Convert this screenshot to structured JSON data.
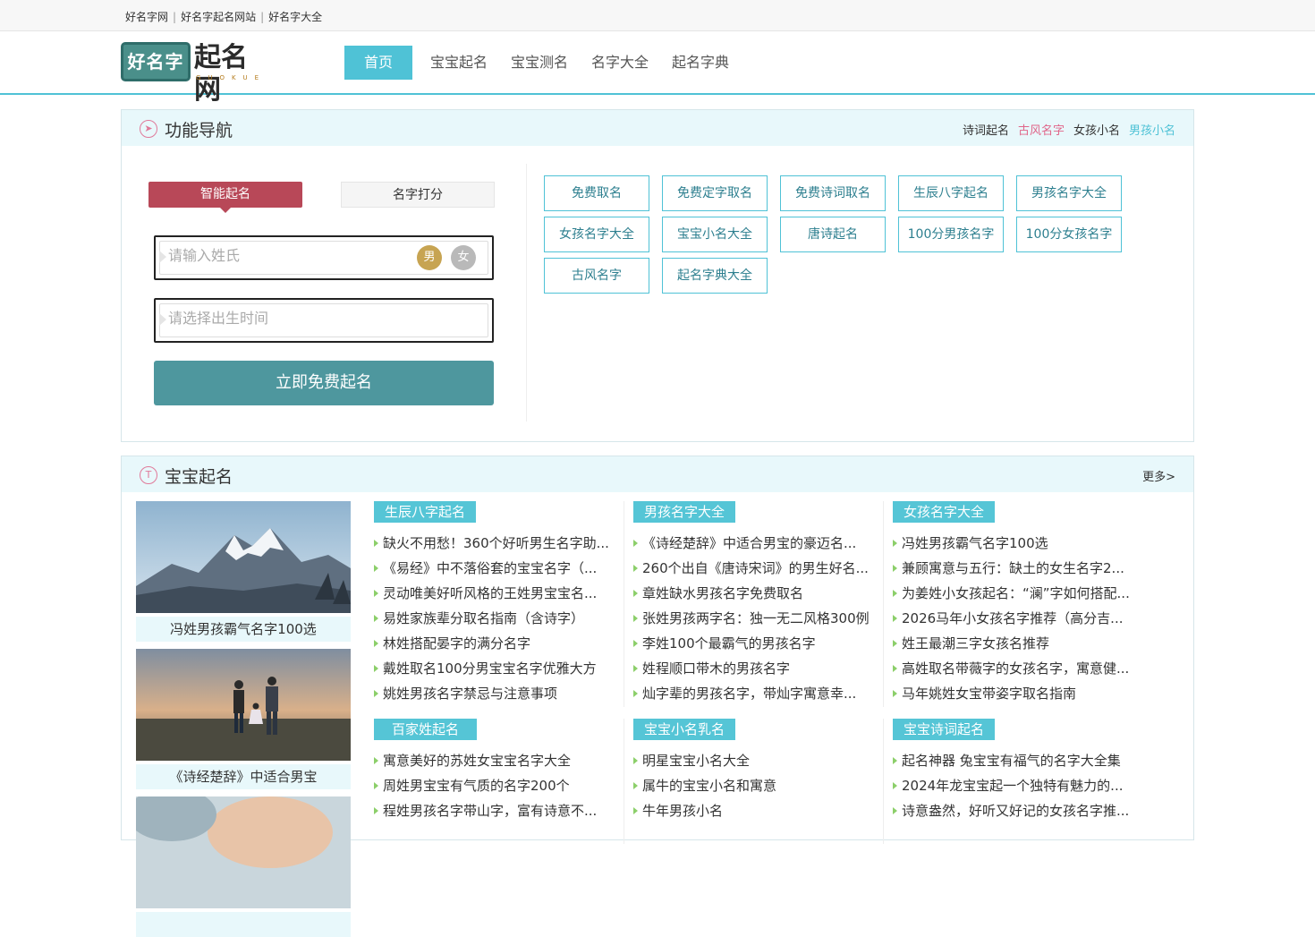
{
  "topbar": {
    "links": [
      "好名字网",
      "好名字起名网站",
      "好名字大全"
    ]
  },
  "logo": {
    "seal": "好名字",
    "text": "起名网",
    "sub": "GUOKUE"
  },
  "nav": [
    {
      "label": "首页",
      "active": true
    },
    {
      "label": "宝宝起名"
    },
    {
      "label": "宝宝测名"
    },
    {
      "label": "名字大全"
    },
    {
      "label": "起名字典"
    }
  ],
  "feature_panel": {
    "title": "功能导航",
    "head_links": [
      {
        "label": "诗词起名",
        "color": "#333333"
      },
      {
        "label": "古风名字",
        "color": "#e0668a"
      },
      {
        "label": "女孩小名",
        "color": "#333333"
      },
      {
        "label": "男孩小名",
        "color": "#4fc2d6"
      }
    ],
    "tabs": [
      "智能起名",
      "名字打分"
    ],
    "surname_placeholder": "请输入姓氏",
    "gender_male": "男",
    "gender_female": "女",
    "birth_placeholder": "请选择出生时间",
    "submit": "立即免费起名",
    "tools": [
      "免费取名",
      "免费定字取名",
      "免费诗词取名",
      "生辰八字起名",
      "男孩名字大全",
      "女孩名字大全",
      "宝宝小名大全",
      "唐诗起名",
      "100分男孩名字",
      "100分女孩名字",
      "古风名字",
      "起名字典大全"
    ]
  },
  "baby_panel": {
    "title": "宝宝起名",
    "more": "更多>",
    "thumbs": [
      {
        "caption": "冯姓男孩霸气名字100选",
        "image": "snowy-mountain"
      },
      {
        "caption": "《诗经楚辞》中适合男宝",
        "image": "family-walk-sunset"
      },
      {
        "caption": "",
        "image": "baby-photo"
      }
    ],
    "columns_row1": [
      {
        "tag": "生辰八字起名",
        "items": [
          "缺火不用愁！360个好听男生名字助...",
          "《易经》中不落俗套的宝宝名字（...",
          "灵动唯美好听风格的王姓男宝宝名...",
          "易姓家族辈分取名指南（含诗字）",
          "林姓搭配晏字的满分名字",
          "戴姓取名100分男宝宝名字优雅大方",
          "姚姓男孩名字禁忌与注意事项"
        ]
      },
      {
        "tag": "男孩名字大全",
        "items": [
          "《诗经楚辞》中适合男宝的豪迈名...",
          "260个出自《唐诗宋词》的男生好名...",
          "章姓缺水男孩名字免费取名",
          "张姓男孩两字名：独一无二风格300例",
          "李姓100个最霸气的男孩名字",
          "姓程顺口带木的男孩名字",
          "灿字辈的男孩名字，带灿字寓意幸..."
        ]
      },
      {
        "tag": "女孩名字大全",
        "items": [
          "冯姓男孩霸气名字100选",
          "兼顾寓意与五行：缺土的女生名字2...",
          "为姜姓小女孩起名：“澜”字如何搭配...",
          "2026马年小女孩名字推荐（高分吉...",
          "姓王最潮三字女孩名推荐",
          "高姓取名带薇字的女孩名字，寓意健...",
          "马年姚姓女宝带姿字取名指南"
        ]
      }
    ],
    "columns_row2": [
      {
        "tag": "百家姓起名",
        "items": [
          "寓意美好的苏姓女宝宝名字大全",
          "周姓男宝宝有气质的名字200个",
          "程姓男孩名字带山字，富有诗意不..."
        ]
      },
      {
        "tag": "宝宝小名乳名",
        "items": [
          "明星宝宝小名大全",
          "属牛的宝宝小名和寓意",
          "牛年男孩小名"
        ]
      },
      {
        "tag": "宝宝诗词起名",
        "items": [
          "起名神器 兔宝宝有福气的名字大全集",
          "2024年龙宝宝起一个独特有魅力的...",
          "诗意盎然，好听又好记的女孩名字推..."
        ]
      }
    ]
  }
}
